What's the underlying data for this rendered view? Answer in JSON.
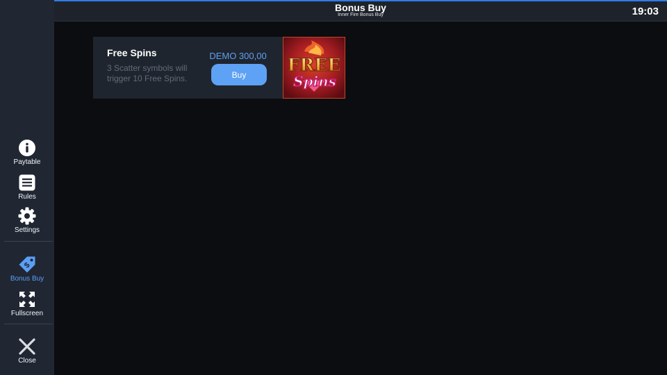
{
  "header": {
    "title": "Bonus Buy",
    "subtitle": "Inner Fire Bonus Buy",
    "clock": "19:03"
  },
  "sidebar": {
    "items": [
      {
        "label": "Paytable",
        "icon": "info-icon"
      },
      {
        "label": "Rules",
        "icon": "list-icon"
      },
      {
        "label": "Settings",
        "icon": "gear-icon"
      },
      {
        "label": "Bonus Buy",
        "icon": "price-tag-icon",
        "active": true
      },
      {
        "label": "Fullscreen",
        "icon": "fullscreen-icon"
      },
      {
        "label": "Close",
        "icon": "close-icon"
      }
    ]
  },
  "offer": {
    "title": "Free Spins",
    "description": "3 Scatter symbols will trigger 10 Free Spins.",
    "price": "DEMO 300,00",
    "buy_label": "Buy",
    "image_text_top": "FREE",
    "image_text_bottom": "Spins"
  },
  "colors": {
    "accent": "#5da2f5",
    "sidebar_bg": "#202733",
    "page_bg": "#0b0d11",
    "card_bg": "#1f252e"
  }
}
